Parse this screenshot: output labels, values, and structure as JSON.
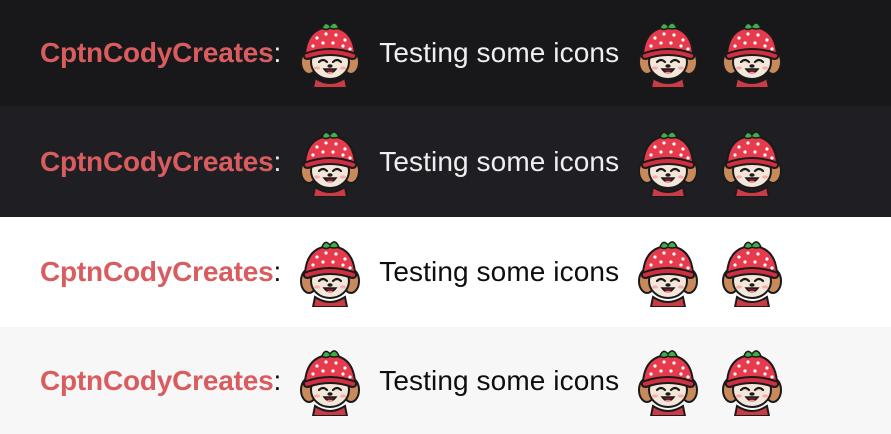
{
  "rows": [
    {
      "theme": "dark",
      "background": "#18181b",
      "text_color": "#efeff1",
      "username": "CptnCodyCreates",
      "separator": ":",
      "message": "Testing some icons",
      "emotes": [
        "strawberry-dog-emote-icon",
        "strawberry-dog-emote-icon",
        "strawberry-dog-emote-icon"
      ]
    },
    {
      "theme": "dark-alt",
      "background": "#1f1f23",
      "text_color": "#efeff1",
      "username": "CptnCodyCreates",
      "separator": ":",
      "message": "Testing some icons",
      "emotes": [
        "strawberry-dog-emote-icon",
        "strawberry-dog-emote-icon",
        "strawberry-dog-emote-icon"
      ]
    },
    {
      "theme": "light",
      "background": "#ffffff",
      "text_color": "#0e0e10",
      "username": "CptnCodyCreates",
      "separator": ":",
      "message": "Testing some icons",
      "emotes": [
        "strawberry-dog-emote-icon",
        "strawberry-dog-emote-icon",
        "strawberry-dog-emote-icon"
      ]
    },
    {
      "theme": "light-alt",
      "background": "#f7f7f8",
      "text_color": "#0e0e10",
      "username": "CptnCodyCreates",
      "separator": ":",
      "message": "Testing some icons",
      "emotes": [
        "strawberry-dog-emote-icon",
        "strawberry-dog-emote-icon",
        "strawberry-dog-emote-icon"
      ]
    }
  ],
  "username_color": "#d95c5f"
}
